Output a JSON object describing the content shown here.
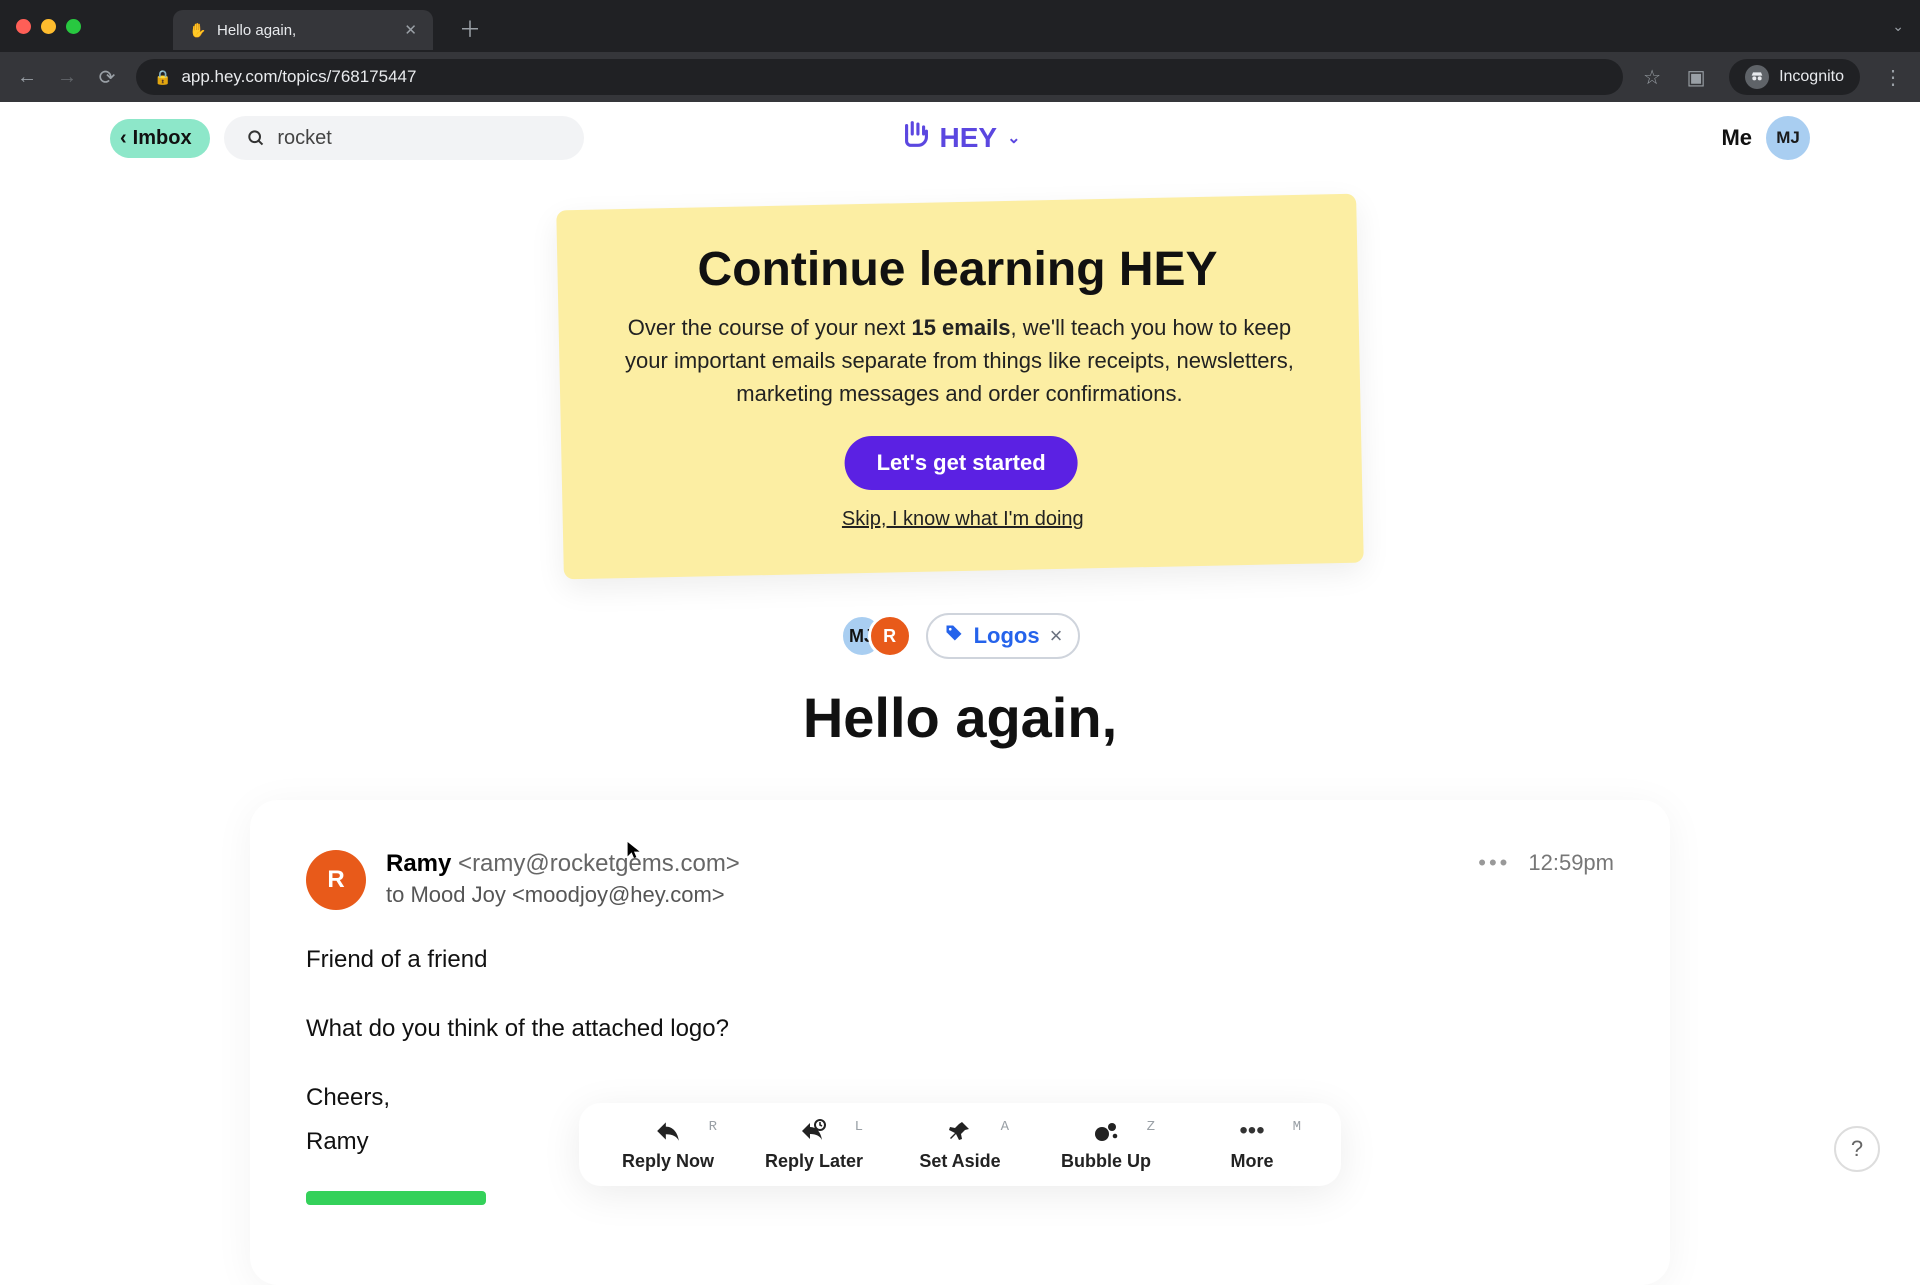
{
  "browser": {
    "tab_title": "Hello again,",
    "url": "app.hey.com/topics/768175447",
    "incognito_label": "Incognito"
  },
  "header": {
    "imbox_label": "Imbox",
    "search_value": "rocket",
    "brand_text": "HEY",
    "me_label": "Me",
    "me_initials": "MJ"
  },
  "banner": {
    "title": "Continue learning HEY",
    "body_prefix": "Over the course of your next ",
    "body_bold": "15 emails",
    "body_suffix": ", we'll teach you how to keep your important emails separate from things like receipts, newsletters, marketing messages and order confirmations.",
    "cta": "Let's get started",
    "skip": "Skip, I know what I'm doing"
  },
  "participants": {
    "a_initials": "MJ",
    "b_initials": "R",
    "label_name": "Logos"
  },
  "thread": {
    "title": "Hello again,"
  },
  "message": {
    "avatar_initial": "R",
    "from_name": "Ramy",
    "from_email": "<ramy@rocketgems.com>",
    "to_line": "to Mood Joy <moodjoy@hey.com>",
    "time": "12:59pm",
    "body": {
      "p1": "Friend of a friend",
      "p2": "What do you think of the attached logo?",
      "p3": "Cheers,",
      "p4": "Ramy"
    }
  },
  "actions": {
    "reply_now": {
      "label": "Reply Now",
      "kb": "R"
    },
    "reply_later": {
      "label": "Reply Later",
      "kb": "L"
    },
    "set_aside": {
      "label": "Set Aside",
      "kb": "A"
    },
    "bubble_up": {
      "label": "Bubble Up",
      "kb": "Z"
    },
    "more": {
      "label": "More",
      "kb": "M"
    }
  },
  "help_label": "?"
}
